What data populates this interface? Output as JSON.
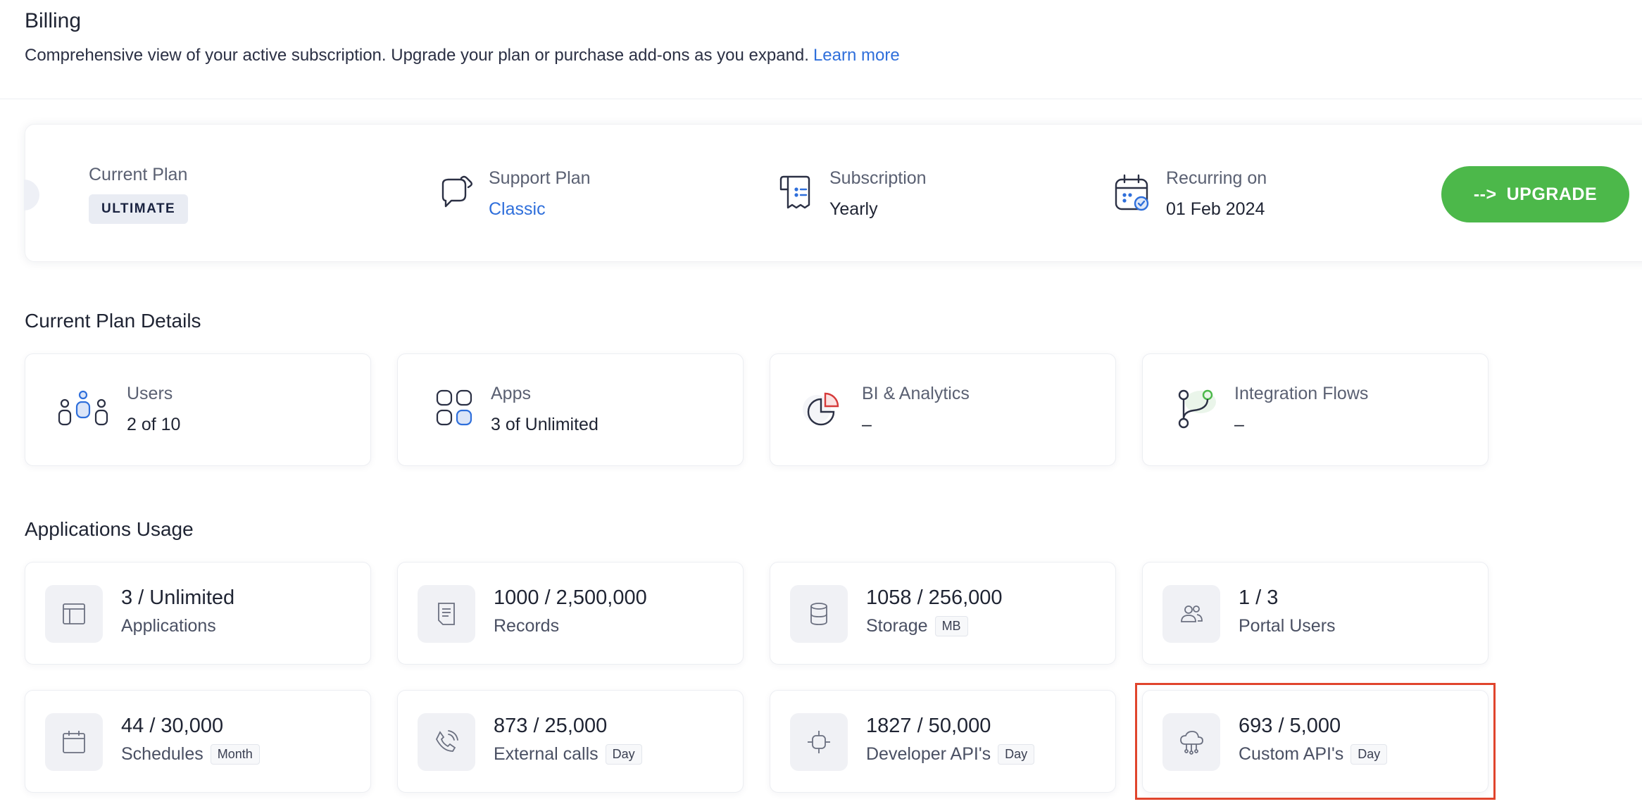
{
  "header": {
    "title": "Billing",
    "description": "Comprehensive view of your active subscription. Upgrade your plan or purchase add-ons as you expand.",
    "learn_more": "Learn more"
  },
  "plan_bar": {
    "current_plan_label": "Current Plan",
    "current_plan_value": "ULTIMATE",
    "support_plan_label": "Support Plan",
    "support_plan_value": "Classic",
    "subscription_label": "Subscription",
    "subscription_value": "Yearly",
    "recurring_label": "Recurring on",
    "recurring_value": "01 Feb 2024",
    "upgrade_arrow": "-->",
    "upgrade_label": "UPGRADE"
  },
  "plan_details": {
    "title": "Current Plan Details",
    "cards": [
      {
        "label": "Users",
        "value": "2 of 10",
        "icon": "users-icon"
      },
      {
        "label": "Apps",
        "value": "3 of Unlimited",
        "icon": "apps-grid-icon"
      },
      {
        "label": "BI & Analytics",
        "value": "–",
        "icon": "pie-chart-icon"
      },
      {
        "label": "Integration Flows",
        "value": "–",
        "icon": "branch-flow-icon"
      }
    ]
  },
  "usage": {
    "title": "Applications Usage",
    "cards": [
      {
        "value": "3 / Unlimited",
        "label": "Applications",
        "unit": "",
        "icon": "application-window-icon"
      },
      {
        "value": "1000 / 2,500,000",
        "label": "Records",
        "unit": "",
        "icon": "document-icon"
      },
      {
        "value": "1058 / 256,000",
        "label": "Storage",
        "unit": "MB",
        "icon": "database-icon"
      },
      {
        "value": "1 / 3",
        "label": "Portal Users",
        "unit": "",
        "icon": "portal-users-icon"
      },
      {
        "value": "44 / 30,000",
        "label": "Schedules",
        "unit": "Month",
        "icon": "calendar-icon"
      },
      {
        "value": "873 / 25,000",
        "label": "External calls",
        "unit": "Day",
        "icon": "phone-call-icon"
      },
      {
        "value": "1827 / 50,000",
        "label": "Developer API's",
        "unit": "Day",
        "icon": "developer-api-icon"
      },
      {
        "value": "693 / 5,000",
        "label": "Custom API's",
        "unit": "Day",
        "icon": "cloud-api-icon"
      }
    ]
  },
  "colors": {
    "accent_green": "#4cb84a",
    "link_blue": "#2f6fdb",
    "highlight_red": "#e0452d"
  }
}
